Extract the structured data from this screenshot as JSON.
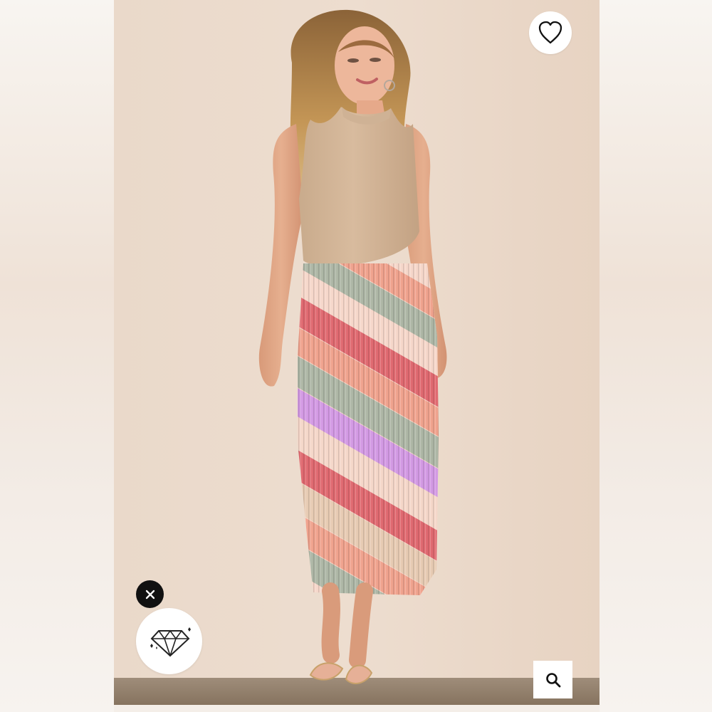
{
  "product_image": {
    "alt": "",
    "colors": {
      "background": "#ead9ca",
      "top": "#d6b99b",
      "skirt_stripes": [
        "#e06a71",
        "#f0a38e",
        "#f5d7c9",
        "#aeb7a6",
        "#d39ae4",
        "#e7cbb3"
      ]
    }
  },
  "controls": {
    "favorite_icon": "heart-icon",
    "zoom_icon": "search-icon",
    "close_icon": "close-icon",
    "badge_icon": "diamond-icon"
  }
}
